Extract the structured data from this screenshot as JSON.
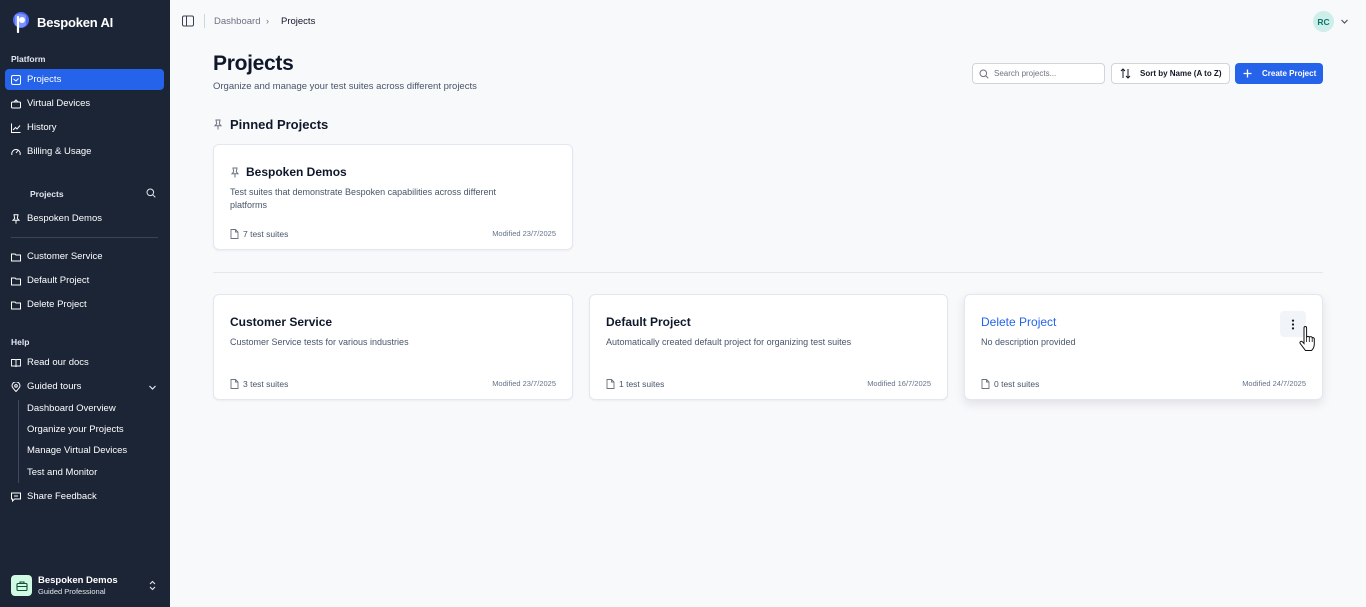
{
  "brand": {
    "name": "Bespoken AI"
  },
  "sidebar": {
    "platform_label": "Platform",
    "platform_items": [
      {
        "label": "Projects",
        "icon": "projects-icon",
        "active": true
      },
      {
        "label": "Virtual Devices",
        "icon": "devices-icon"
      },
      {
        "label": "History",
        "icon": "chart-line-icon"
      },
      {
        "label": "Billing & Usage",
        "icon": "gauge-icon"
      }
    ],
    "projects_label": "Projects",
    "pinned_projects": [
      {
        "label": "Bespoken Demos",
        "icon": "pin-icon"
      }
    ],
    "projects": [
      {
        "label": "Customer Service",
        "icon": "folder-icon"
      },
      {
        "label": "Default Project",
        "icon": "folder-icon"
      },
      {
        "label": "Delete Project",
        "icon": "folder-icon"
      }
    ],
    "help_label": "Help",
    "help_items": [
      {
        "label": "Read our docs",
        "icon": "book-icon"
      },
      {
        "label": "Guided tours",
        "icon": "map-pin-icon"
      }
    ],
    "tours": [
      "Dashboard Overview",
      "Organize your Projects",
      "Manage Virtual Devices",
      "Test and Monitor"
    ],
    "feedback": {
      "label": "Share Feedback",
      "icon": "message-icon"
    },
    "workspace": {
      "name": "Bespoken Demos",
      "plan": "Guided Professional"
    }
  },
  "topbar": {
    "breadcrumb": [
      "Dashboard",
      "Projects"
    ],
    "user_initials": "RC"
  },
  "header": {
    "title": "Projects",
    "subtitle": "Organize and manage your test suites across different projects",
    "search_placeholder": "Search projects...",
    "sort_label": "Sort by Name (A to Z)",
    "create_label": "Create Project"
  },
  "pinned_section": {
    "title": "Pinned Projects"
  },
  "pinned_cards": [
    {
      "title": "Bespoken Demos",
      "description": "Test suites that demonstrate Bespoken capabilities across different platforms",
      "count": "7 test suites",
      "modified": "Modified 23/7/2025"
    }
  ],
  "cards": [
    {
      "title": "Customer Service",
      "description": "Customer Service tests for various industries",
      "count": "3 test suites",
      "modified": "Modified 23/7/2025"
    },
    {
      "title": "Default Project",
      "description": "Automatically created default project for organizing test suites",
      "count": "1 test suites",
      "modified": "Modified 16/7/2025"
    },
    {
      "title": "Delete Project",
      "description": "No description provided",
      "count": "0 test suites",
      "modified": "Modified 24/7/2025"
    }
  ],
  "colors": {
    "sidebar_bg": "#1c2536",
    "accent": "#2563eb",
    "page_bg": "#f8f9fb"
  }
}
